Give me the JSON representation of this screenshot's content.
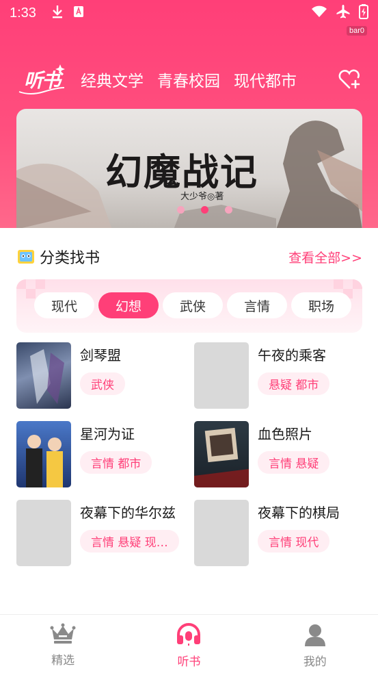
{
  "status": {
    "time": "1:33",
    "badge": "bar0"
  },
  "header": {
    "logo": "听书",
    "tabs": [
      {
        "label": "经典文学"
      },
      {
        "label": "青春校园"
      },
      {
        "label": "现代都市"
      }
    ],
    "fav_icon": "heart-plus-icon"
  },
  "banner": {
    "title": "幻魔战记",
    "author": "大少爷◎著",
    "page_count": 3,
    "active_page": 2
  },
  "section": {
    "title": "分类找书",
    "more_label": "查看全部>>"
  },
  "categories": [
    {
      "label": "现代",
      "active": false
    },
    {
      "label": "幻想",
      "active": true
    },
    {
      "label": "武侠",
      "active": false
    },
    {
      "label": "言情",
      "active": false
    },
    {
      "label": "职场",
      "active": false
    }
  ],
  "books": [
    {
      "title": "剑琴盟",
      "tags": "武侠",
      "cover": "image"
    },
    {
      "title": "午夜的乘客",
      "tags": "悬疑 都市",
      "cover": "placeholder"
    },
    {
      "title": "星河为证",
      "tags": "言情 都市",
      "cover": "image"
    },
    {
      "title": "血色照片",
      "tags": "言情 悬疑",
      "cover": "image"
    },
    {
      "title": "夜幕下的华尔兹",
      "tags": "言情 悬疑 现…",
      "cover": "placeholder"
    },
    {
      "title": "夜幕下的棋局",
      "tags": "言情 现代",
      "cover": "placeholder"
    }
  ],
  "tabbar": [
    {
      "label": "精选",
      "icon": "crown-icon",
      "active": false
    },
    {
      "label": "听书",
      "icon": "headphones-icon",
      "active": true
    },
    {
      "label": "我的",
      "icon": "user-icon",
      "active": false
    }
  ],
  "colors": {
    "accent": "#ff3f78",
    "tag_bg": "#ffeef3"
  }
}
